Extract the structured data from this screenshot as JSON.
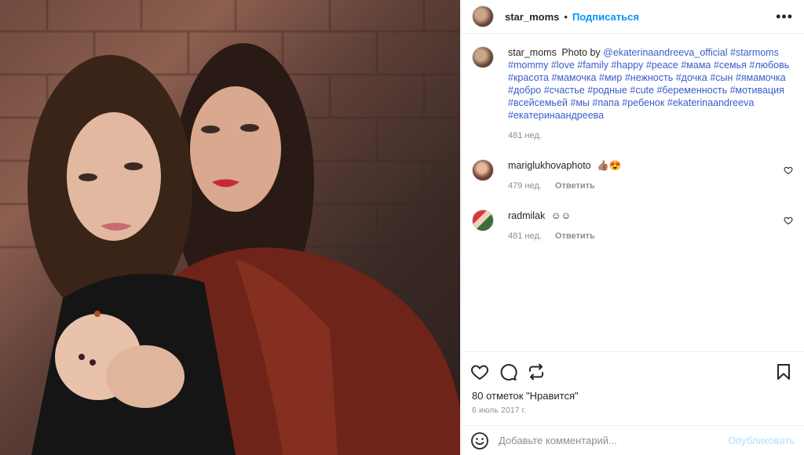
{
  "post": {
    "username": "star_moms",
    "follow_label": "Подписаться",
    "more_label": "•••"
  },
  "caption": {
    "username": "star_moms",
    "lead": "Photo by",
    "mention": "@ekaterinaandreeva_official",
    "hashtags": [
      "#starmoms",
      "#mommy",
      "#love",
      "#family",
      "#happy",
      "#peace",
      "#мама",
      "#семья",
      "#любовь",
      "#красота",
      "#мамочка",
      "#мир",
      "#нежность",
      "#дочка",
      "#сын",
      "#ямамочка",
      "#добро",
      "#счастье",
      "#родные",
      "#cute",
      "#беременность",
      "#мотивация",
      "#всейсемьей",
      "#мы",
      "#папа",
      "#ребенок",
      "#ekaterinaandreeva",
      "#екатеринаандреева"
    ],
    "time": "481 нед."
  },
  "comments": [
    {
      "username": "mariglukhovaphoto",
      "text": "👍🏽😍",
      "time": "479 нед.",
      "reply_label": "Ответить"
    },
    {
      "username": "radmilak",
      "text": "☺☺",
      "time": "481 нед.",
      "reply_label": "Ответить"
    }
  ],
  "actions": {
    "likes_text": "80 отметок \"Нравится\"",
    "date_text": "6 июль 2017 г."
  },
  "add_comment": {
    "placeholder": "Добавьте комментарий...",
    "post_label": "Опубликовать"
  },
  "icons": {
    "like": "heart-icon",
    "comment": "comment-icon",
    "share": "repost-icon",
    "save": "bookmark-icon",
    "emoji": "emoji-icon"
  },
  "colors": {
    "accent": "#0095f6",
    "hashtag": "#3a5ccc",
    "muted": "#8e8e8e"
  }
}
